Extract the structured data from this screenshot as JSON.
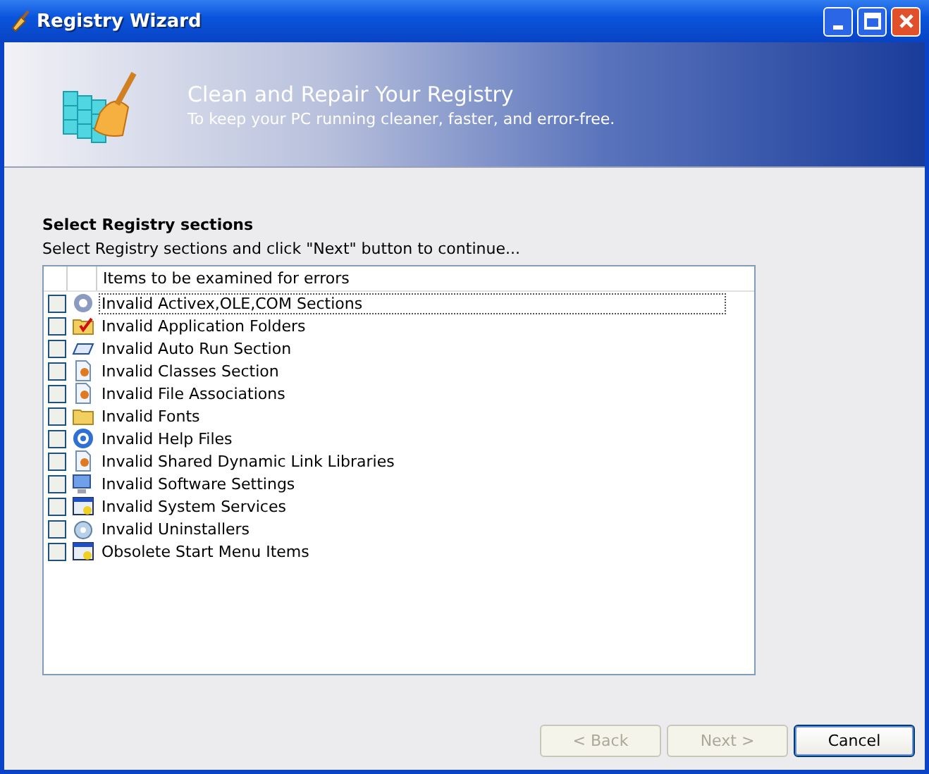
{
  "window": {
    "title": "Registry Wizard"
  },
  "header": {
    "title": "Clean and Repair Your Registry",
    "subtitle": "To keep your PC running cleaner, faster, and error-free."
  },
  "section": {
    "title": "Select Registry sections",
    "instruction": "Select Registry sections and click \"Next\" button to continue..."
  },
  "list": {
    "column": "Items to be examined for errors",
    "items": [
      {
        "label": "Invalid Activex,OLE,COM Sections",
        "checked": false,
        "focused": true
      },
      {
        "label": "Invalid Application Folders",
        "checked": false,
        "focused": false
      },
      {
        "label": "Invalid Auto Run Section",
        "checked": false,
        "focused": false
      },
      {
        "label": "Invalid Classes Section",
        "checked": false,
        "focused": false
      },
      {
        "label": "Invalid File Associations",
        "checked": false,
        "focused": false
      },
      {
        "label": "Invalid Fonts",
        "checked": false,
        "focused": false
      },
      {
        "label": "Invalid Help Files",
        "checked": false,
        "focused": false
      },
      {
        "label": "Invalid Shared Dynamic Link Libraries",
        "checked": false,
        "focused": false
      },
      {
        "label": "Invalid Software Settings",
        "checked": false,
        "focused": false
      },
      {
        "label": "Invalid System Services",
        "checked": false,
        "focused": false
      },
      {
        "label": "Invalid Uninstallers",
        "checked": false,
        "focused": false
      },
      {
        "label": "Obsolete Start Menu Items",
        "checked": false,
        "focused": false
      }
    ]
  },
  "buttons": [
    {
      "label": "< Back",
      "disabled": true,
      "default": false
    },
    {
      "label": "Next >",
      "disabled": true,
      "default": false
    },
    {
      "label": "Cancel",
      "disabled": false,
      "default": true
    }
  ]
}
